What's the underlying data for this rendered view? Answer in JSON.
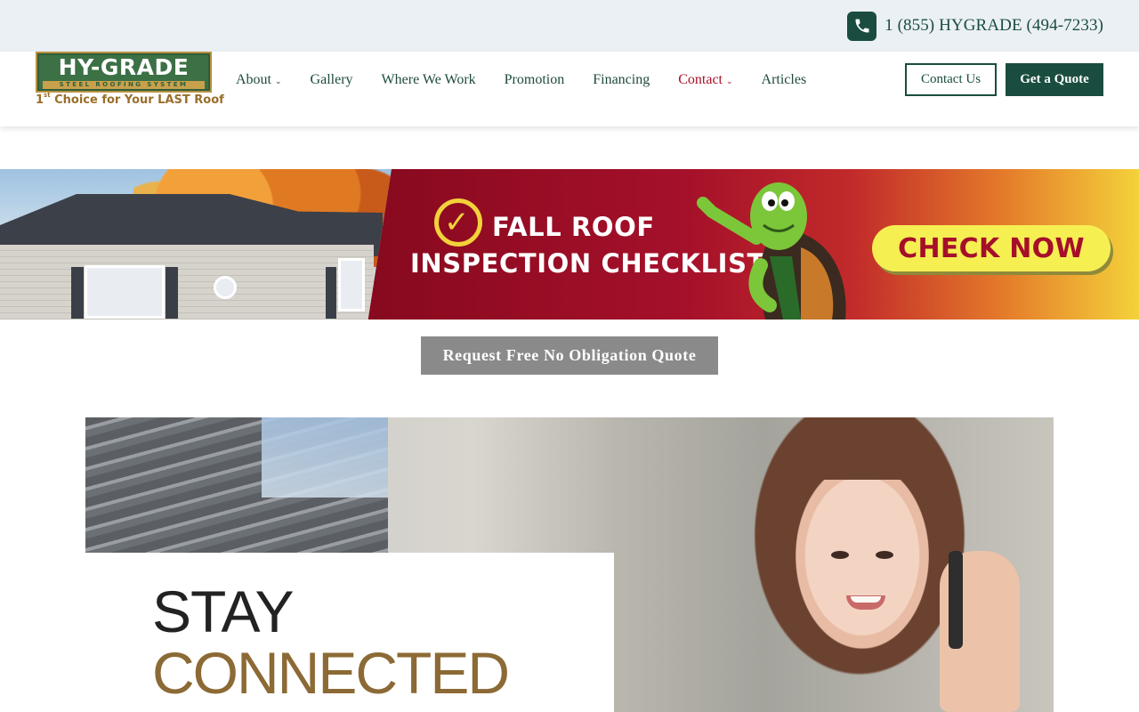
{
  "topbar": {
    "phone_icon": "phone-icon",
    "phone_number": "1 (855) HYGRADE (494-7233)"
  },
  "logo": {
    "title": "HY-GRADE",
    "subtitle": "STEEL ROOFING SYSTEM",
    "tagline_prefix": "1",
    "tagline_sup": "st",
    "tagline_rest": " Choice for Your LAST Roof"
  },
  "nav": {
    "items": [
      {
        "label": "About",
        "has_dropdown": true
      },
      {
        "label": "Gallery",
        "has_dropdown": false
      },
      {
        "label": "Where We Work",
        "has_dropdown": false
      },
      {
        "label": "Promotion",
        "has_dropdown": false
      },
      {
        "label": "Financing",
        "has_dropdown": false
      },
      {
        "label": "Contact",
        "has_dropdown": true,
        "active": true
      },
      {
        "label": "Articles",
        "has_dropdown": false
      }
    ],
    "chevron": "⌄",
    "contact_us": "Contact Us",
    "get_quote": "Get a Quote"
  },
  "banner": {
    "line1": "FALL ROOF",
    "line2": "INSPECTION CHECKLIST",
    "check_now": "CHECK NOW"
  },
  "quote_button": "Request Free No Obligation Quote",
  "hero": {
    "line1": "STAY",
    "line2": "CONNECTED"
  },
  "colors": {
    "brand_green": "#1a4d3f",
    "accent_red": "#a81028",
    "topbar_bg": "#ebf0f5",
    "gold": "#8c6a35"
  }
}
